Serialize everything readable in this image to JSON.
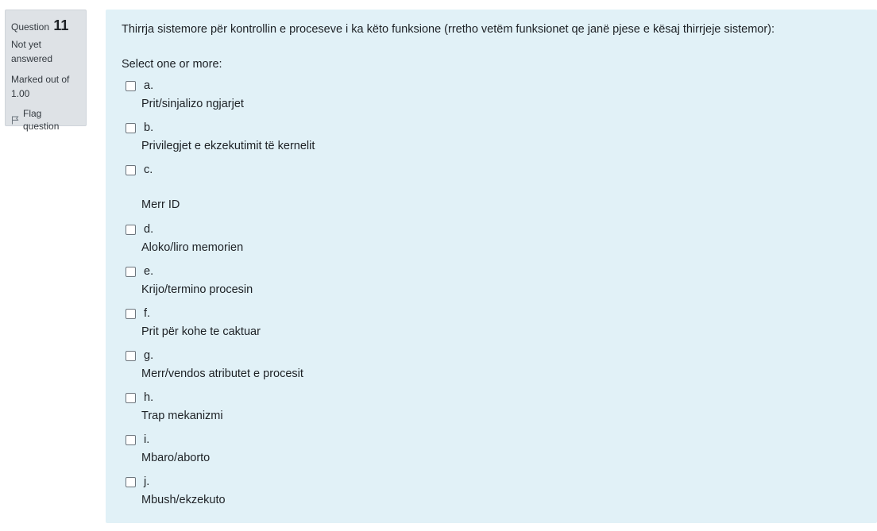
{
  "info": {
    "question_label": "Question",
    "question_number": "11",
    "state": "Not yet answered",
    "grade": "Marked out of 1.00",
    "flag_label": "Flag question"
  },
  "question": {
    "text": "Thirrja sistemore për kontrollin e proceseve i ka këto funksione (rretho vetëm funksionet qe janë pjese e kësaj thirrjeje sistemor):",
    "prompt": "Select one or more:",
    "options": [
      {
        "letter": "a.",
        "label": "Prit/sinjalizo ngjarjet",
        "checked": false
      },
      {
        "letter": "b.",
        "label": "Privilegjet e ekzekutimit të kernelit",
        "checked": false
      },
      {
        "letter": "c.",
        "label": "Merr ID",
        "checked": false
      },
      {
        "letter": "d.",
        "label": "Aloko/liro memorien",
        "checked": false
      },
      {
        "letter": "e.",
        "label": "Krijo/termino procesin",
        "checked": false
      },
      {
        "letter": "f.",
        "label": "Prit për kohe te caktuar",
        "checked": false
      },
      {
        "letter": "g.",
        "label": "Merr/vendos atributet e procesit",
        "checked": false
      },
      {
        "letter": "h.",
        "label": "Trap mekanizmi",
        "checked": false
      },
      {
        "letter": "i.",
        "label": "Mbaro/aborto",
        "checked": false
      },
      {
        "letter": "j.",
        "label": "Mbush/ekzekuto",
        "checked": false
      }
    ]
  },
  "colors": {
    "formulation_bg": "#e1f1f7",
    "info_bg": "#dee2e6"
  }
}
